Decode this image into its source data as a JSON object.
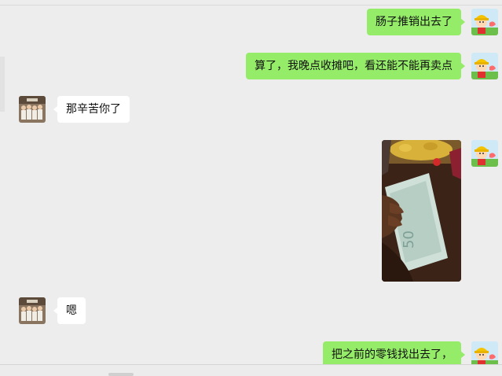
{
  "chat": {
    "messages": [
      {
        "sender": "me",
        "type": "text",
        "text": "肠子推销出去了"
      },
      {
        "sender": "me",
        "type": "text",
        "text": "算了，我晚点收摊吧，看还能不能再卖点"
      },
      {
        "sender": "other",
        "type": "text",
        "text": "那辛苦你了"
      },
      {
        "sender": "me",
        "type": "image",
        "description": "photo of banknote"
      },
      {
        "sender": "other",
        "type": "text",
        "text": "嗯"
      },
      {
        "sender": "me",
        "type": "text",
        "text": "把之前的零钱找出去了，"
      }
    ]
  },
  "colors": {
    "background": "#ededed",
    "bubble_self": "#95ec69",
    "bubble_other": "#ffffff"
  },
  "icons": {
    "self_avatar": "cartoon-child-yellow-hat-avatar",
    "other_avatar": "group-photo-avatar"
  }
}
